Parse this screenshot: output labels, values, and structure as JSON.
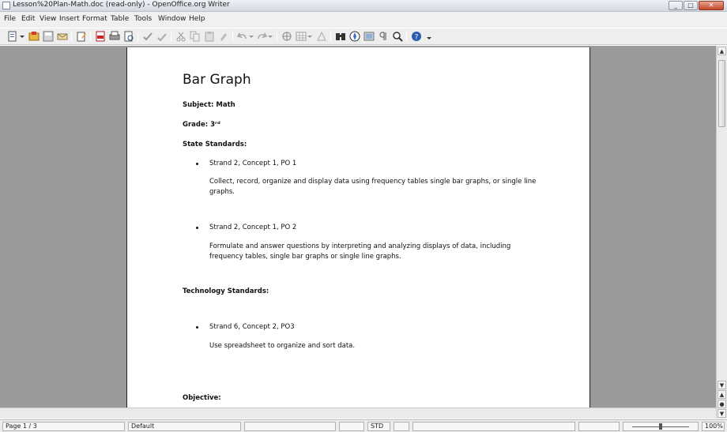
{
  "window": {
    "title": "Lesson%20Plan-Math.doc (read-only) - OpenOffice.org Writer",
    "controls": [
      "_",
      "□",
      "✕"
    ]
  },
  "menu": [
    "File",
    "Edit",
    "View",
    "Insert",
    "Format",
    "Table",
    "Tools",
    "Window",
    "Help"
  ],
  "toolbar": {
    "icons": [
      "new-icon",
      "open-icon",
      "save-icon",
      "mail-icon",
      "edit-file-icon",
      "export-pdf-icon",
      "print-icon",
      "print-preview-icon",
      "spellcheck-icon",
      "autospell-icon",
      "cut-icon",
      "copy-icon",
      "paste-icon",
      "format-paintbrush-icon",
      "undo-icon",
      "redo-icon",
      "hyperlink-icon",
      "table-icon",
      "draw-functions-icon",
      "find-replace-icon",
      "navigator-icon",
      "gallery-icon",
      "nonprinting-chars-icon",
      "zoom-icon",
      "help-icon"
    ]
  },
  "document": {
    "title": "Bar Graph",
    "subject": "Subject: Math",
    "grade": "Grade: 3ʳᵈ",
    "state_standards_heading": "State Standards:",
    "bullets": [
      {
        "heading": "Strand 2, Concept 1, PO 1",
        "text": "Collect, record, organize and display data using frequency tables single bar graphs, or single line graphs."
      },
      {
        "heading": "Strand 2, Concept 1, PO 2",
        "text": "Formulate and answer questions by interpreting and analyzing displays of data, including frequency tables, single bar graphs or single line graphs."
      }
    ],
    "technology_heading": "Technology Standards:",
    "tech_bullets": [
      {
        "heading": "Strand 6, Concept 2, PO3",
        "text": "Use spreadsheet to organize and sort data."
      }
    ],
    "objective_heading": "Objective:"
  },
  "status": {
    "page": "Page 1 / 3",
    "style": "Default",
    "insert_mode": "STD",
    "selection_mode": "",
    "layout": "",
    "zoom": "100%"
  }
}
